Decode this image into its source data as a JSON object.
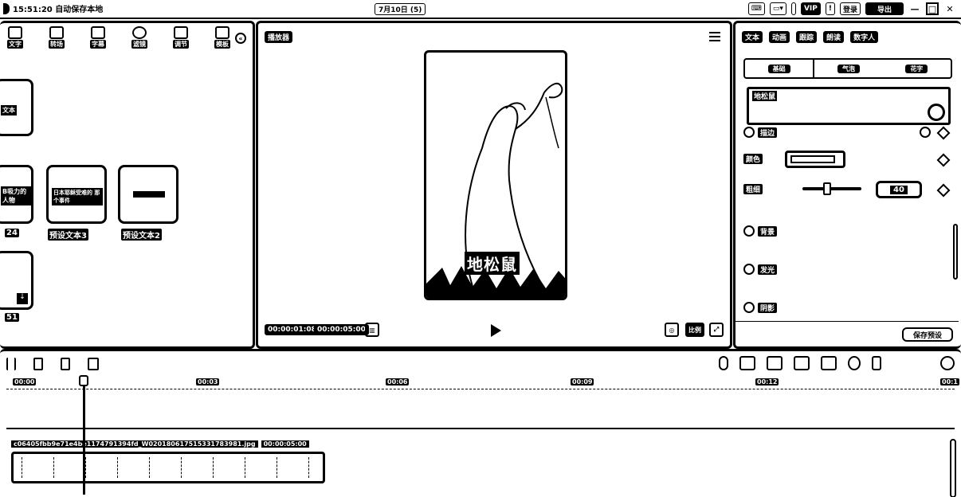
{
  "titlebar": {
    "autosave": "15:51:20 自动保存本地",
    "date": "7月10日 (5)",
    "vip": "VIP",
    "login": "登录",
    "export": "导出"
  },
  "media": {
    "tabs": [
      {
        "label": "文字"
      },
      {
        "label": "转场"
      },
      {
        "label": "字幕"
      },
      {
        "label": "滤镜"
      },
      {
        "label": "调节"
      },
      {
        "label": "模板"
      }
    ],
    "cards": [
      {
        "chip": "文本"
      },
      {
        "chip": "B吸力的 人物"
      },
      {
        "chip": "日本耶稣受难的 那个事件",
        "label": "预设文本3"
      },
      {
        "chip": "",
        "label": "预设文本2"
      }
    ],
    "side_labels": [
      "24",
      "51"
    ]
  },
  "player": {
    "tag": "播放器",
    "video_title": "地松鼠",
    "current_time": "00:00:01:08",
    "total_time": "00:00:05:00",
    "ratio": "比例",
    "fullscreen": "全屏"
  },
  "inspector": {
    "tabs": [
      "文本",
      "动画",
      "跟踪",
      "朗读",
      "数字人"
    ],
    "sub_tabs": [
      "基础",
      "气泡",
      "花字"
    ],
    "text_value": "地松鼠",
    "stroke_label": "描边",
    "color_label": "颜色",
    "thickness_label": "粗细",
    "thickness_value": "40",
    "background_label": "背景",
    "glow_label": "发光",
    "shadow_label": "阴影",
    "reset_button": "保存预设"
  },
  "timeline": {
    "ticks": [
      "00:00",
      "00:03",
      "00:06",
      "00:09",
      "00:12",
      "00:1"
    ],
    "clip_name": "c06405fbb9e71e4be1174791394fd_W020180617515331783981.jpg",
    "clip_duration": "00:00:05:00"
  }
}
